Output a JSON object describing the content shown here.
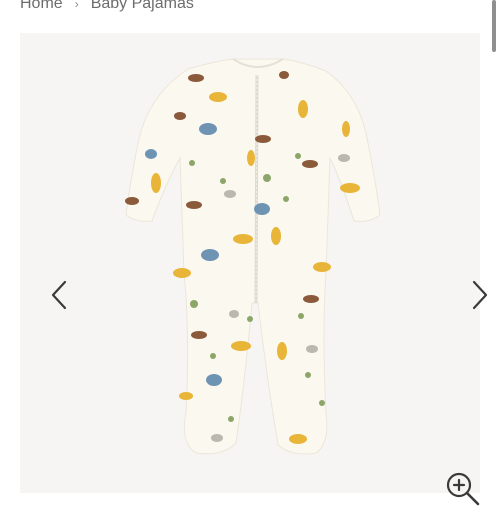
{
  "breadcrumb": {
    "items": [
      {
        "label": "Home"
      },
      {
        "label": "Baby Pajamas"
      }
    ],
    "separator": "›"
  },
  "gallery": {
    "image_alt": "Baby sleepsuit with safari animal print",
    "colors": {
      "background": "#f6f5f3",
      "garment": "#fbf8ef",
      "zipper": "#e2dfd6",
      "print_blue": "#6f94b3",
      "print_yellow": "#e8b538",
      "print_brown": "#8a5a3b",
      "print_green": "#8ca66a"
    },
    "icons": {
      "prev": "chevron-left-icon",
      "next": "chevron-right-icon",
      "zoom": "zoom-in-icon"
    }
  }
}
